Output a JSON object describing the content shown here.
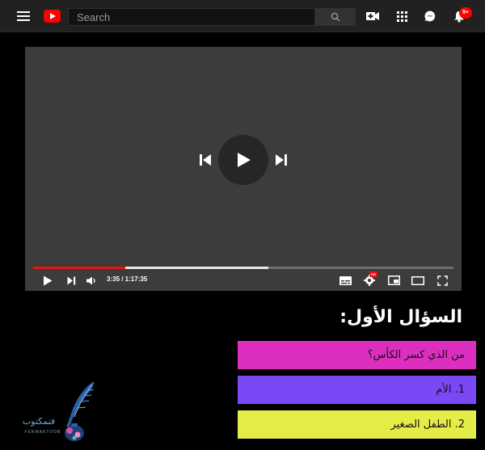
{
  "header": {
    "search_placeholder": "Search",
    "notification_count": "9+"
  },
  "player": {
    "time_display": "3:35 / 1:17:35",
    "progress_played_fraction": 0.22,
    "progress_buffered_fraction": 0.56,
    "hd_label": "HD"
  },
  "quiz": {
    "title": "السؤال الأول:",
    "question": "من الذي كسر الكأس؟",
    "options": [
      "1. الأم",
      "2. الطفل الصغير"
    ]
  },
  "watermark": {
    "text": "فنمكتوب",
    "subtext": "FENMAKTOOB"
  },
  "colors": {
    "question_bg": "#dc2fc0",
    "option1_bg": "#7b48f6",
    "option2_bg": "#e4ec48",
    "progress_red": "#ee1111"
  },
  "icons": [
    "menu-icon",
    "youtube-logo",
    "search-icon",
    "create-video-icon",
    "apps-grid-icon",
    "messages-icon",
    "notifications-bell-icon",
    "previous-icon",
    "play-icon",
    "next-icon",
    "volume-icon",
    "subtitles-icon",
    "settings-gear-icon",
    "miniplayer-icon",
    "theater-icon",
    "fullscreen-icon"
  ]
}
